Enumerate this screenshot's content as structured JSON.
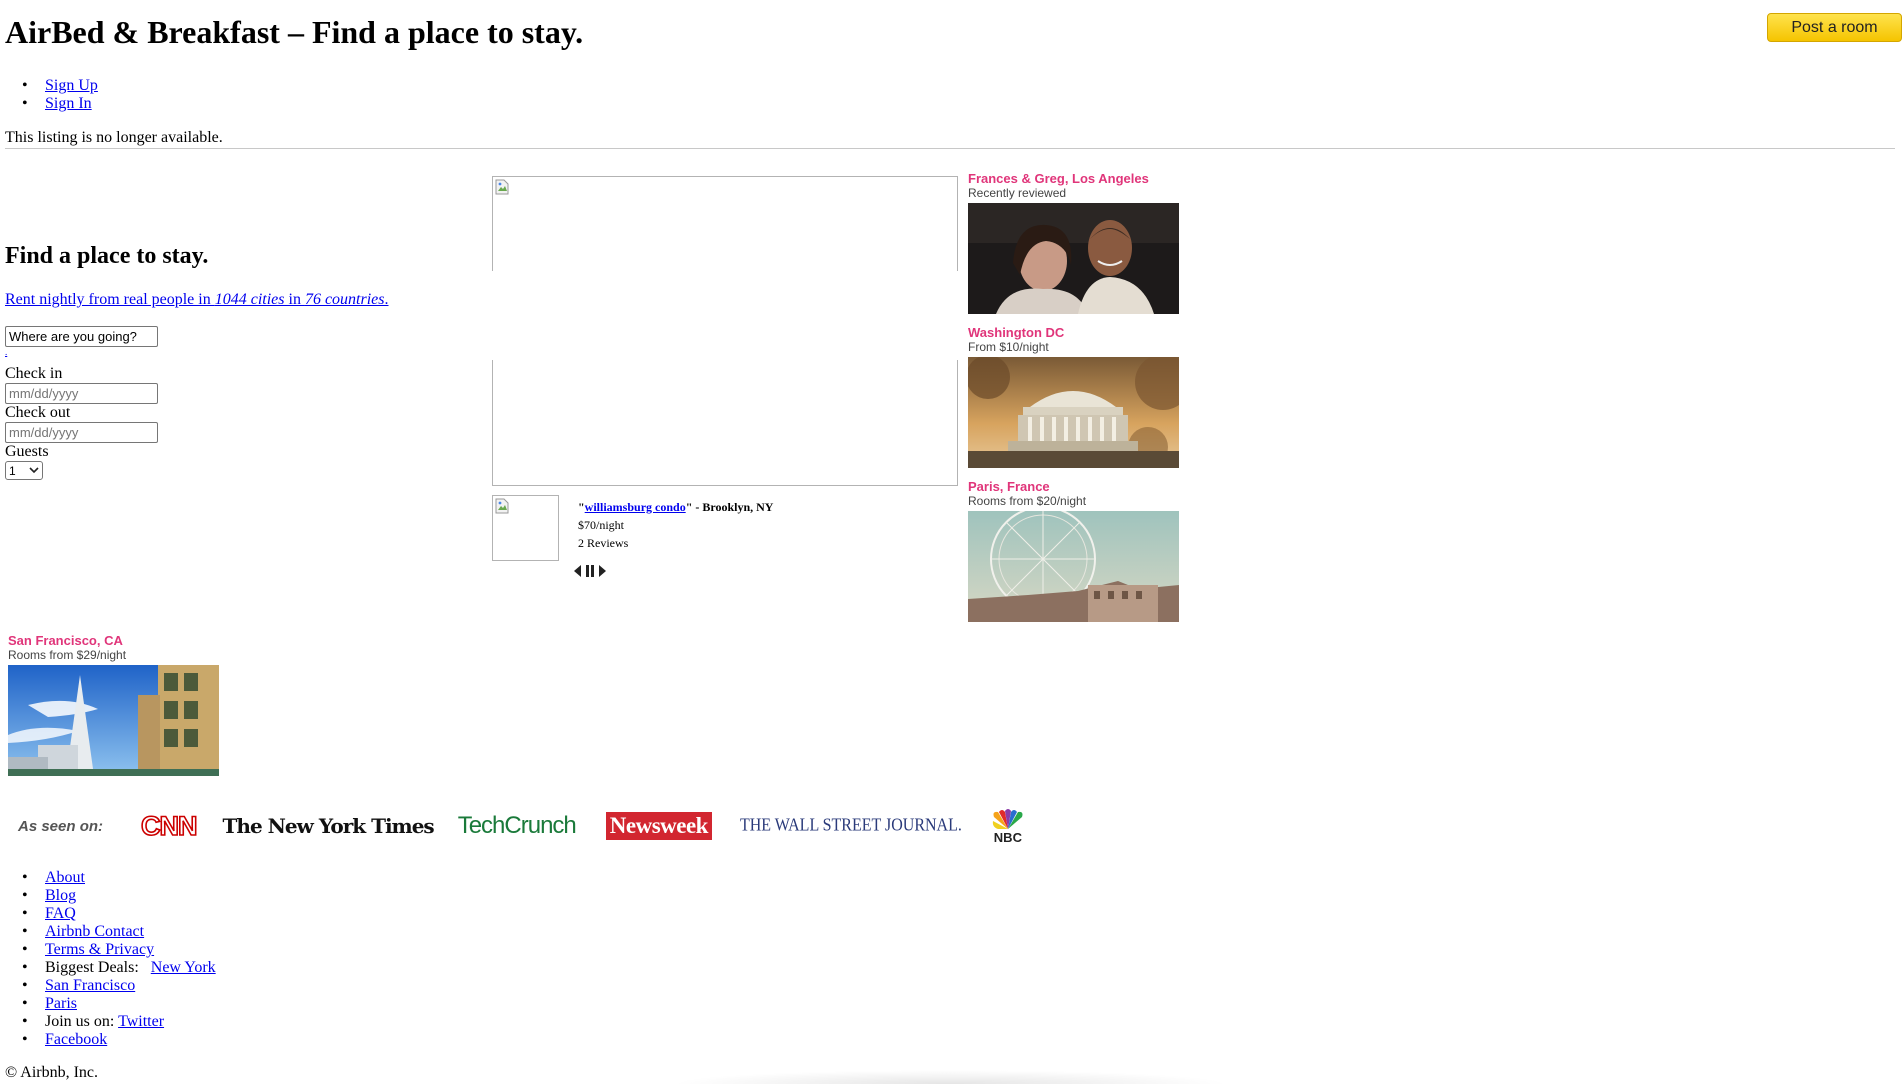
{
  "header": {
    "title": "AirBed & Breakfast – Find a place to stay.",
    "post_room_label": "Post a room"
  },
  "top_nav": {
    "items": [
      "Sign Up",
      "Sign In"
    ]
  },
  "notice": "This listing is no longer available.",
  "search": {
    "heading": "Find a place to stay.",
    "rent_prefix": "Rent nightly from real people in ",
    "cities": "1044 cities",
    "rent_middle": " in ",
    "countries": "76 countries",
    "rent_suffix": ".",
    "where_value": "Where are you going?",
    "dot_link": ".",
    "checkin_label": "Check in",
    "checkin_placeholder": "mm/dd/yyyy",
    "checkout_label": "Check out",
    "checkout_placeholder": "mm/dd/yyyy",
    "guests_label": "Guests",
    "guests_selected": "1"
  },
  "featured": {
    "quote_open": "\"",
    "listing_name": "williamsburg condo",
    "quote_close_location": "\" - Brooklyn, NY",
    "price": "$70/night",
    "reviews": "2 Reviews"
  },
  "cards": {
    "la": {
      "title": "Frances & Greg, Los Angeles",
      "subtitle": "Recently reviewed"
    },
    "dc": {
      "title": "Washington DC",
      "subtitle": "From $10/night"
    },
    "paris": {
      "title": "Paris, France",
      "subtitle": "Rooms from $20/night"
    },
    "sf": {
      "title": "San Francisco, CA",
      "subtitle": "Rooms from $29/night"
    }
  },
  "press": {
    "label": "As seen on:",
    "cnn": "CNN",
    "nyt": "The New York Times",
    "techcrunch": "TechCrunch",
    "newsweek": "Newsweek",
    "wsj": "THE WALL STREET JOURNAL.",
    "nbc": "NBC"
  },
  "footer": {
    "about": "About",
    "blog": "Blog",
    "faq": "FAQ",
    "contact": "Airbnb Contact",
    "terms": "Terms & Privacy",
    "deals_label": "Biggest Deals:",
    "deals_ny": "New York",
    "deals_sf": "San Francisco",
    "deals_paris": "Paris",
    "join_label": "Join us on:",
    "twitter": "Twitter",
    "facebook": "Facebook",
    "copyright": "© Airbnb, Inc."
  },
  "colors": {
    "card_title": "#e0357a",
    "button": "#ffd520",
    "link": "#0000ee"
  }
}
